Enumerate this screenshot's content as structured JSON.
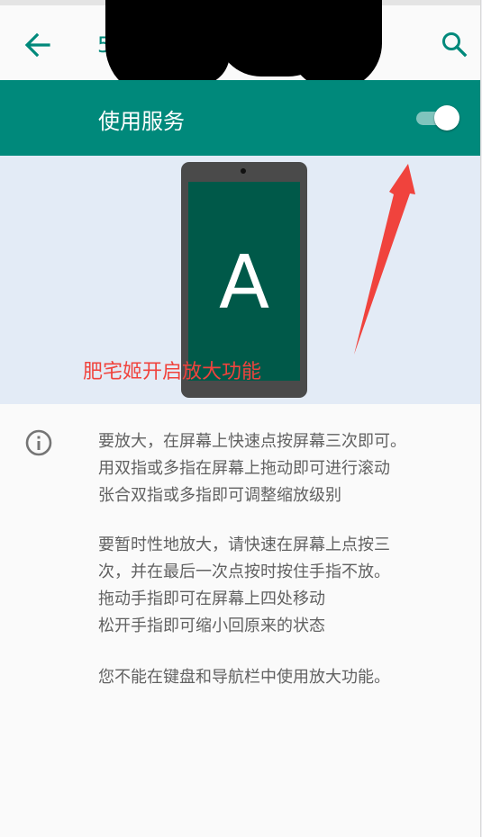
{
  "appbar": {
    "title_partial": "5",
    "back_icon": "arrow-left-icon",
    "search_icon": "search-icon"
  },
  "service_toggle": {
    "label": "使用服务",
    "on": true
  },
  "illustration": {
    "phone_letter": "A",
    "annotation": "肥宅姬开启放大功能"
  },
  "info": {
    "icon": "info-icon",
    "paragraphs": [
      [
        "要放大，在屏幕上快速点按屏幕三次即可。",
        "用双指或多指在屏幕上拖动即可进行滚动",
        "张合双指或多指即可调整缩放级别"
      ],
      [
        "要暂时性地放大，请快速在屏幕上点按三",
        "次，并在最后一次点按时按住手指不放。",
        "拖动手指即可在屏幕上四处移动",
        "松开手指即可缩小回原来的状态"
      ],
      [
        "您不能在键盘和导航栏中使用放大功能。"
      ]
    ]
  },
  "colors": {
    "accent": "#00897b",
    "toggle_bar": "#00897b",
    "illustration_bg": "#e3ebf6",
    "phone_screen": "#005949",
    "annotation": "#f0433d",
    "body_text": "#616161"
  }
}
